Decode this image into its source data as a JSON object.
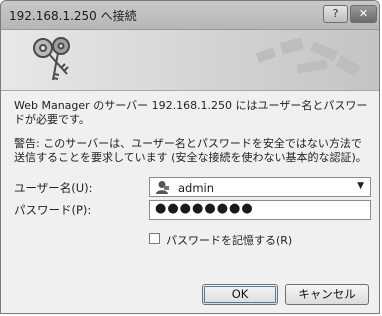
{
  "window": {
    "title": "192.168.1.250 へ接続",
    "help_label": "?",
    "close_label": "✕"
  },
  "messages": {
    "info": "Web Manager のサーバー 192.168.1.250 にはユーザー名とパスワードが必要です。",
    "warning": "警告: このサーバーは、ユーザー名とパスワードを安全ではない方法で送信することを要求しています (安全な接続を使わない基本的な認証)。"
  },
  "form": {
    "username_label": "ユーザー名(U):",
    "username_value": "admin",
    "password_label": "パスワード(P):",
    "password_mask": "●●●●●●●●",
    "remember_label": "パスワードを記憶する(R)",
    "remember_checked": false
  },
  "buttons": {
    "ok": "OK",
    "cancel": "キャンセル"
  },
  "icons": {
    "banner": "keys-icon",
    "user": "user-icon",
    "dropdown": "chevron-down-icon"
  }
}
